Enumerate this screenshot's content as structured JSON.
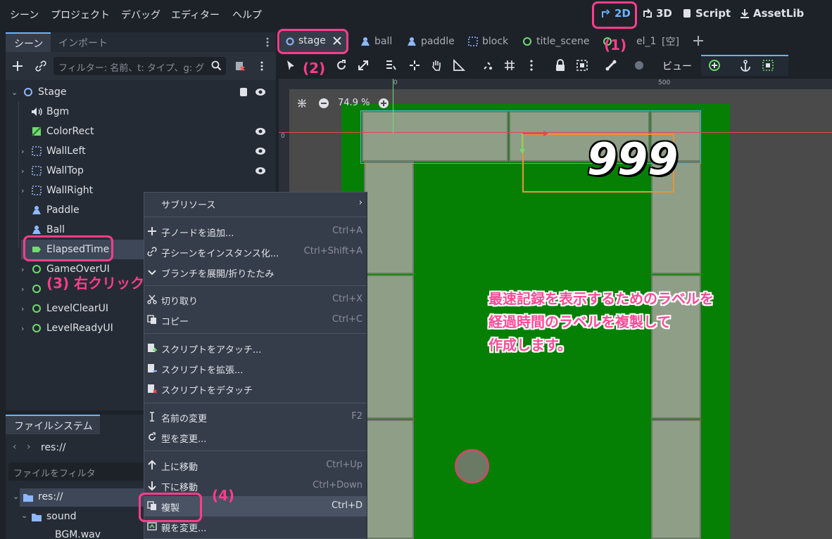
{
  "menu": [
    "シーン",
    "プロジェクト",
    "デバッグ",
    "エディター",
    "ヘルプ"
  ],
  "modes": {
    "m2d": "2D",
    "m3d": "3D",
    "script": "Script",
    "assetlib": "AssetLib"
  },
  "dock": {
    "tab_scene": "シーン",
    "tab_import": "インポート",
    "filter_placeholder": "フィルター: 名前、t: タイプ、g: グ"
  },
  "tree": [
    {
      "label": "Stage"
    },
    {
      "label": "Bgm"
    },
    {
      "label": "ColorRect"
    },
    {
      "label": "WallLeft"
    },
    {
      "label": "WallTop"
    },
    {
      "label": "WallRight"
    },
    {
      "label": "Paddle"
    },
    {
      "label": "Ball"
    },
    {
      "label": "ElapsedTime"
    },
    {
      "label": "GameOverUI"
    },
    {
      "label": "LevelClearUI"
    },
    {
      "label": "LevelReadyUI"
    }
  ],
  "filesystem": {
    "tab": "ファイルシステム",
    "path": "res://",
    "filter_placeholder": "ファイルをフィルタ",
    "items": [
      "res://",
      "sound",
      "BGM.wav"
    ]
  },
  "scene_tabs": [
    "stage",
    "ball",
    "paddle",
    "block",
    "title_scene",
    "el_1",
    "[空]"
  ],
  "toolbar": {
    "view_label": "ビュー"
  },
  "viewport": {
    "zoom": "74.9 %",
    "ruler_0": "0",
    "ruler_500": "500",
    "ruler_y0": "0",
    "score": "999"
  },
  "context_menu": [
    {
      "label": "サブリソース",
      "shortcut": ""
    },
    {
      "label": "子ノードを追加...",
      "shortcut": "Ctrl+A"
    },
    {
      "label": "子シーンをインスタンス化...",
      "shortcut": "Ctrl+Shift+A"
    },
    {
      "label": "ブランチを展開/折りたたみ",
      "shortcut": ""
    },
    {
      "label": "切り取り",
      "shortcut": "Ctrl+X"
    },
    {
      "label": "コピー",
      "shortcut": "Ctrl+C"
    },
    {
      "label": "スクリプトをアタッチ...",
      "shortcut": ""
    },
    {
      "label": "スクリプトを拡張...",
      "shortcut": ""
    },
    {
      "label": "スクリプトをデタッチ",
      "shortcut": ""
    },
    {
      "label": "名前の変更",
      "shortcut": "F2"
    },
    {
      "label": "型を変更...",
      "shortcut": ""
    },
    {
      "label": "上に移動",
      "shortcut": "Ctrl+Up"
    },
    {
      "label": "下に移動",
      "shortcut": "Ctrl+Down"
    },
    {
      "label": "複製",
      "shortcut": "Ctrl+D"
    },
    {
      "label": "親を変更...",
      "shortcut": ""
    }
  ],
  "annotations": {
    "a1": "(1)",
    "a2": "(2)",
    "a3": "(3) 右クリック",
    "a4": "(4)",
    "note": [
      "最速記録を表示するためのラベルを",
      "経過時間のラベルを複製して",
      "作成します。"
    ]
  },
  "colors": {
    "accent": "#6ab4ff",
    "highlight": "#ff3d8b",
    "field": "#058005"
  }
}
